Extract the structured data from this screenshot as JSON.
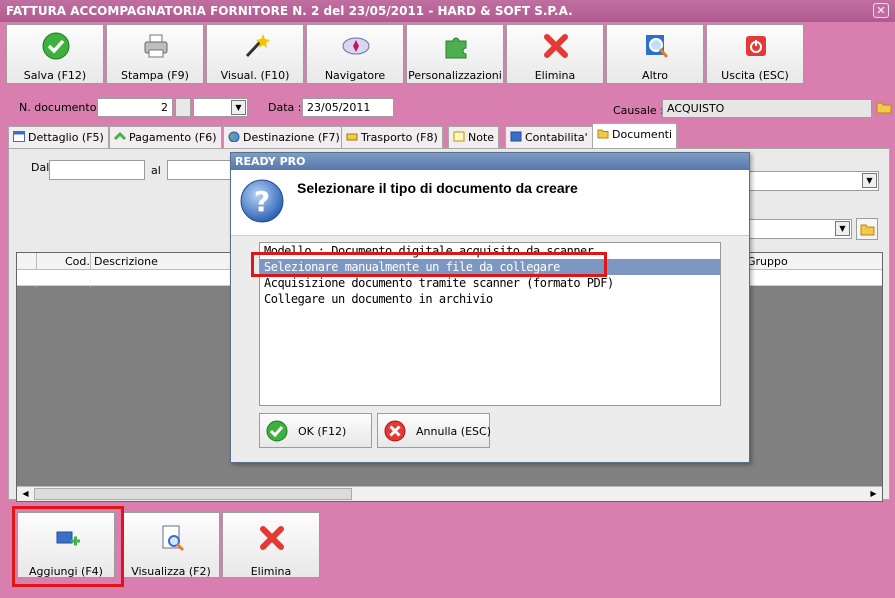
{
  "window": {
    "title": "FATTURA ACCOMPAGNATORIA FORNITORE N. 2 del 23/05/2011 - HARD & SOFT S.P.A.",
    "close_glyph": "✕"
  },
  "toolbar": {
    "buttons": [
      {
        "label": "Salva (F12)",
        "icon": "check-icon"
      },
      {
        "label": "Stampa (F9)",
        "icon": "printer-icon"
      },
      {
        "label": "Visual. (F10)",
        "icon": "magic-wand-icon"
      },
      {
        "label": "Navigatore",
        "icon": "compass-icon"
      },
      {
        "label": "Personalizzazioni",
        "icon": "puzzle-icon"
      },
      {
        "label": "Elimina",
        "icon": "red-x-icon"
      },
      {
        "label": "Altro",
        "icon": "magnifier-icon"
      },
      {
        "label": "Uscita (ESC)",
        "icon": "power-icon"
      }
    ]
  },
  "header": {
    "num_doc_label": "N. documento :",
    "num_doc_value": "2",
    "data_label": "Data :",
    "data_value": "23/05/2011",
    "causale_label": "Causale :",
    "causale_value": "ACQUISTO"
  },
  "tabs": [
    {
      "label": "Dettaglio (F5)"
    },
    {
      "label": "Pagamento (F6)"
    },
    {
      "label": "Destinazione (F7)"
    },
    {
      "label": "Trasporto (F8)"
    },
    {
      "label": "Note"
    },
    {
      "label": "Contabilita'"
    },
    {
      "label": "Documenti"
    }
  ],
  "filters": {
    "dal_label": "Dal",
    "al_label": "al"
  },
  "grid": {
    "columns": [
      "Cod.",
      "Descrizione",
      "Gruppo"
    ]
  },
  "bottom_buttons": [
    {
      "label": "Aggiungi (F4)",
      "icon": "add-document-icon"
    },
    {
      "label": "Visualizza (F2)",
      "icon": "view-document-icon"
    },
    {
      "label": "Elimina",
      "icon": "red-x-icon"
    }
  ],
  "dialog": {
    "title": "READY PRO",
    "heading": "Selezionare il tipo di documento da creare",
    "options": [
      "Modello : Documento digitale acquisito da scanner",
      "Selezionare manualmente un file da collegare",
      "Acquisizione documento tramite scanner (formato PDF)",
      "Collegare un documento in archivio"
    ],
    "selected_index": 1,
    "ok_label": "OK (F12)",
    "cancel_label": "Annulla (ESC)"
  },
  "colors": {
    "window_bg": "#d97fb0",
    "title_bar": "#b05a92",
    "dialog_title": "#5878ad",
    "selection": "#7c98c2",
    "highlight_box": "#e01515"
  }
}
